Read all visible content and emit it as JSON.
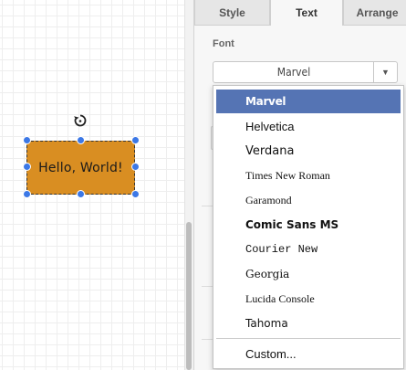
{
  "canvas": {
    "shape_text": "Hello, World!",
    "shape_color": "#d98e22",
    "handle_color": "#3c78e6"
  },
  "tabs": [
    {
      "label": "Style",
      "active": false
    },
    {
      "label": "Text",
      "active": true
    },
    {
      "label": "Arrange",
      "active": false
    }
  ],
  "font_section": {
    "label": "Font",
    "selected_font": "Marvel",
    "dropdown_arrow": "▼"
  },
  "dropdown": {
    "options": [
      {
        "label": "Marvel",
        "selected": true
      },
      {
        "label": "Helvetica",
        "selected": false
      },
      {
        "label": "Verdana",
        "selected": false
      },
      {
        "label": "Times New Roman",
        "selected": false
      },
      {
        "label": "Garamond",
        "selected": false
      },
      {
        "label": "Comic Sans MS",
        "selected": false
      },
      {
        "label": "Courier New",
        "selected": false
      },
      {
        "label": "Georgia",
        "selected": false
      },
      {
        "label": "Lucida Console",
        "selected": false
      },
      {
        "label": "Tahoma",
        "selected": false
      }
    ],
    "custom_label": "Custom...",
    "selected_color": "#5574b4"
  }
}
